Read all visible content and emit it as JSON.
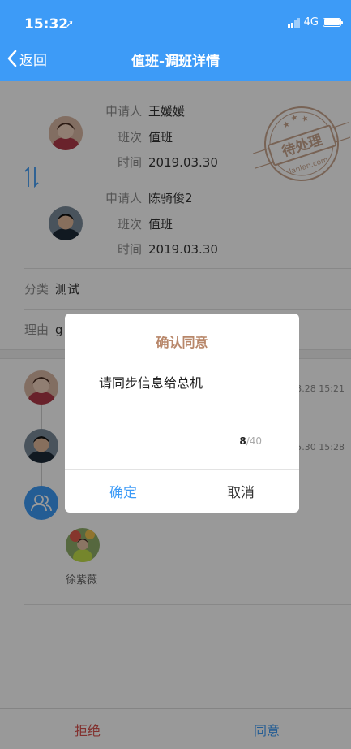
{
  "status_bar": {
    "time": "15:32",
    "network": "4G",
    "location_icon": "location-arrow-icon"
  },
  "nav": {
    "back_label": "返回",
    "title": "值班-调班详情"
  },
  "swap_card": {
    "applicant_a": {
      "label_applicant": "申请人",
      "name": "王媛媛",
      "label_shift": "班次",
      "shift": "值班",
      "label_time": "时间",
      "time": "2019.03.30"
    },
    "applicant_b": {
      "label_applicant": "申请人",
      "name": "陈骑俊2",
      "label_shift": "班次",
      "shift": "值班",
      "label_time": "时间",
      "time": "2019.03.30"
    },
    "stamp_text": "待处理",
    "stamp_subtext": "lanlan.com",
    "swap_icon": "swap-vertical-icon"
  },
  "fields": {
    "category_label": "分类",
    "category_value": "测试",
    "reason_label": "理由",
    "reason_value": "g"
  },
  "timeline": {
    "items": [
      {
        "time": "03.28 15:21"
      },
      {
        "time": "05.30 15:28"
      }
    ],
    "approver_name": "徐紫薇"
  },
  "dialog": {
    "title": "确认同意",
    "message": "请同步信息给总机",
    "count_current": "8",
    "count_max": "/40",
    "confirm_label": "确定",
    "cancel_label": "取消"
  },
  "bottom": {
    "reject_label": "拒绝",
    "approve_label": "同意"
  },
  "colors": {
    "primary": "#3d9bf7",
    "reject": "#d9534f",
    "dialog_title": "#b8876a"
  }
}
